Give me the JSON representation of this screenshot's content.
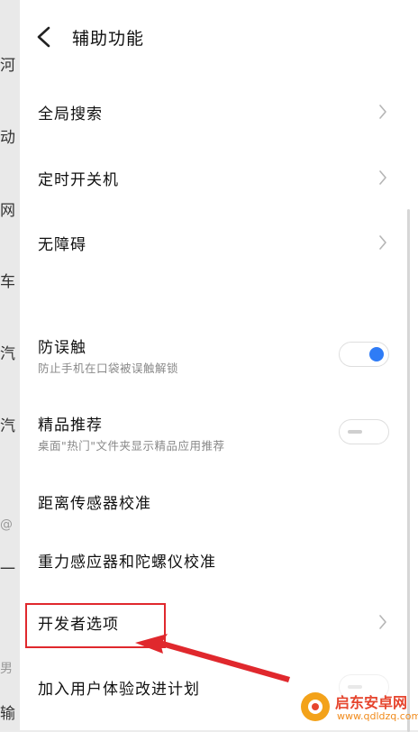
{
  "background_fragments": [
    "河",
    "动",
    "网",
    "车",
    "汽",
    "汽",
    "@",
    "一",
    "男",
    "输"
  ],
  "header": {
    "title": "辅助功能"
  },
  "rows": [
    {
      "label": "全局搜索"
    },
    {
      "label": "定时开关机"
    },
    {
      "label": "无障碍"
    },
    {
      "label": "防误触",
      "sub": "防止手机在口袋被误触解锁",
      "toggle_on": true
    },
    {
      "label": "精品推荐",
      "sub": "桌面\"热门\"文件夹显示精品应用推荐",
      "toggle_on": false
    },
    {
      "label": "距离传感器校准"
    },
    {
      "label": "重力感应器和陀螺仪校准"
    },
    {
      "label": "开发者选项"
    },
    {
      "label": "加入用户体验改进计划"
    }
  ],
  "annotation": {
    "highlight_color": "#e0282d"
  },
  "watermark": {
    "name": "启东安卓网",
    "url": "www.qdldzq.com"
  },
  "colors": {
    "accent": "#2f7cf6",
    "panel": "#ffffff",
    "background": "#ececec"
  }
}
